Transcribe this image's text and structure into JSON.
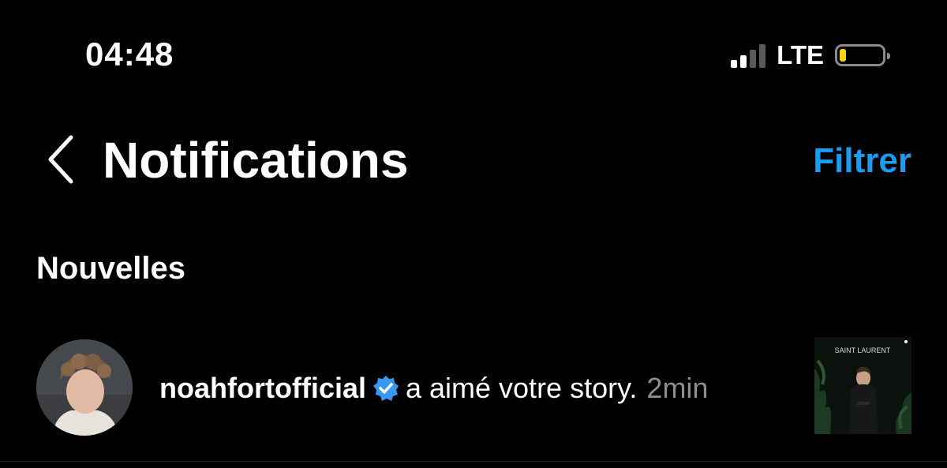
{
  "status_bar": {
    "time": "04:48",
    "network": "LTE",
    "signal_bars_active": 2,
    "signal_bars_total": 4,
    "battery_level": 0.15,
    "battery_color": "#f5d60a"
  },
  "header": {
    "title": "Notifications",
    "filter_label": "Filtrer",
    "accent_color": "#1d9bf0",
    "back_icon": "chevron-left-icon"
  },
  "sections": [
    {
      "title": "Nouvelles",
      "items": [
        {
          "username": "noahfortofficial",
          "verified": true,
          "action": "a aimé votre story.",
          "time": "2min",
          "story_thumbnail_text": "SAINT LAURENT"
        }
      ]
    }
  ]
}
